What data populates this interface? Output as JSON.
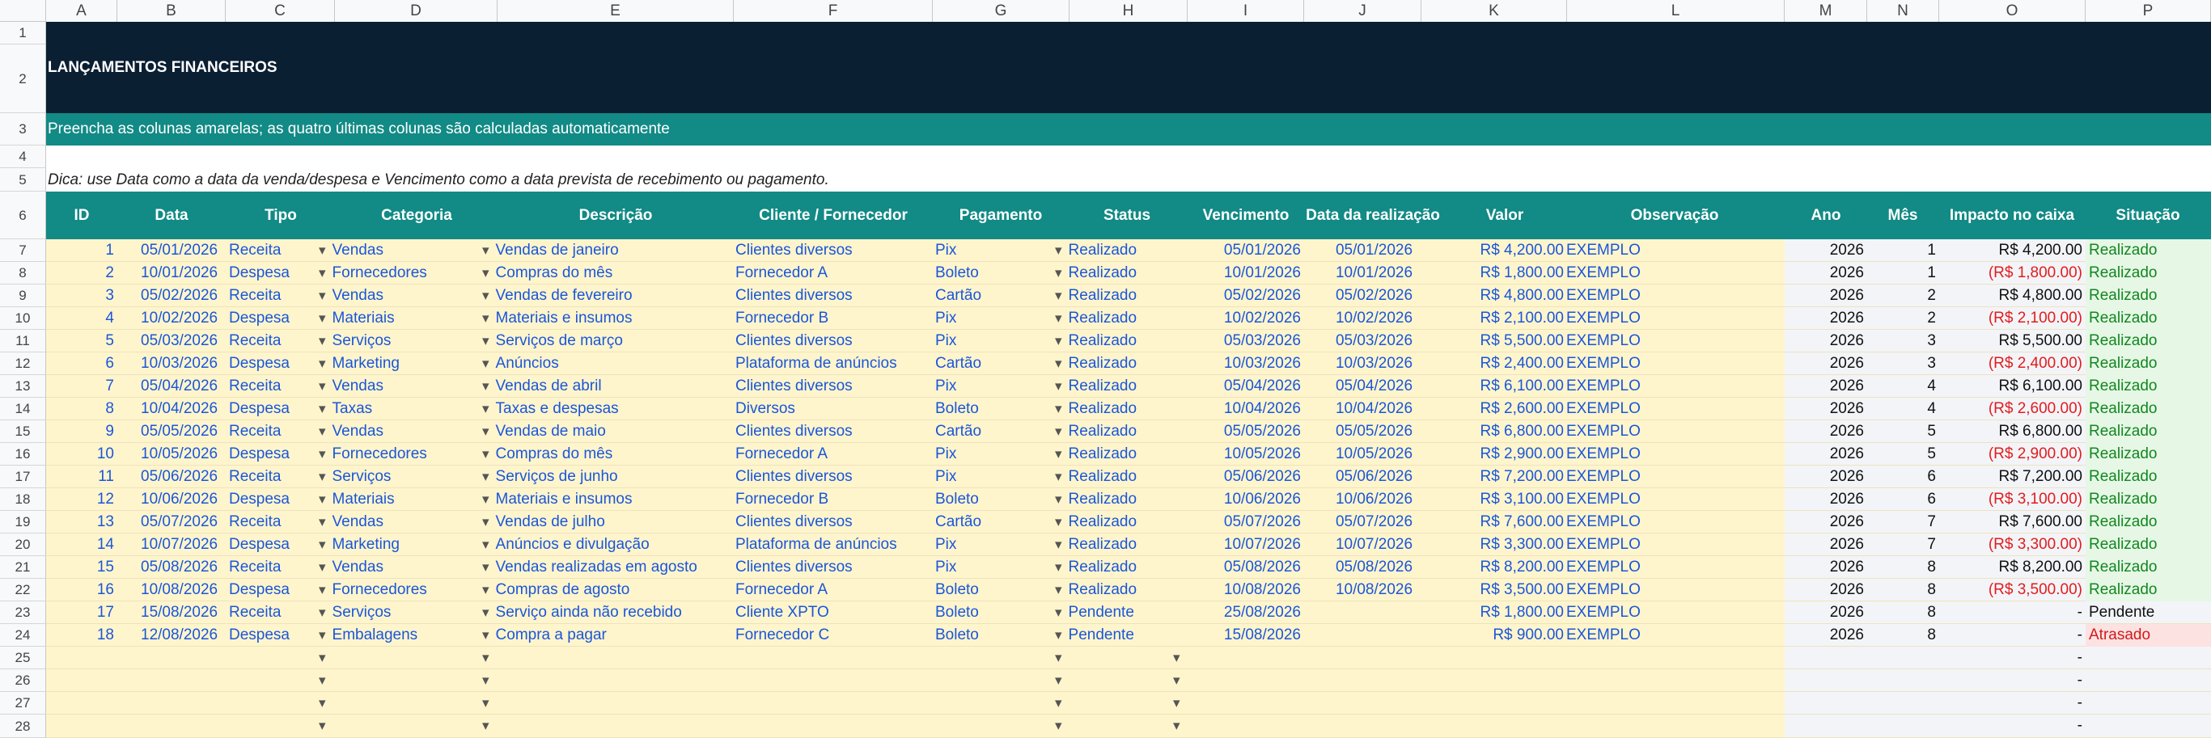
{
  "columns": [
    "A",
    "B",
    "C",
    "D",
    "E",
    "F",
    "G",
    "H",
    "I",
    "J",
    "K",
    "L",
    "M",
    "N",
    "O",
    "P"
  ],
  "title": "LANÇAMENTOS FINANCEIROS",
  "subtitle": "Preencha as colunas amarelas; as quatro últimas colunas são calculadas automaticamente",
  "tip": "Dica: use Data como a data da venda/despesa e Vencimento como a data prevista de recebimento ou pagamento.",
  "headers": [
    "ID",
    "Data",
    "Tipo",
    "Categoria",
    "Descrição",
    "Cliente / Fornecedor",
    "Pagamento",
    "Status",
    "Vencimento",
    "Data da realização",
    "Valor",
    "Observação",
    "Ano",
    "Mês",
    "Impacto no caixa",
    "Situação"
  ],
  "rows": [
    {
      "id": "1",
      "data": "05/01/2026",
      "tipo": "Receita",
      "categoria": "Vendas",
      "descricao": "Vendas de janeiro",
      "cliente": "Clientes diversos",
      "pagamento": "Pix",
      "status": "Realizado",
      "vencimento": "05/01/2026",
      "realizacao": "05/01/2026",
      "valor": "R$ 4,200.00",
      "obs": "EXEMPLO",
      "ano": "2026",
      "mes": "1",
      "impacto": "R$ 4,200.00",
      "neg": false,
      "situacao": "Realizado",
      "sit": "ok"
    },
    {
      "id": "2",
      "data": "10/01/2026",
      "tipo": "Despesa",
      "categoria": "Fornecedores",
      "descricao": "Compras do mês",
      "cliente": "Fornecedor A",
      "pagamento": "Boleto",
      "status": "Realizado",
      "vencimento": "10/01/2026",
      "realizacao": "10/01/2026",
      "valor": "R$ 1,800.00",
      "obs": "EXEMPLO",
      "ano": "2026",
      "mes": "1",
      "impacto": "(R$ 1,800.00)",
      "neg": true,
      "situacao": "Realizado",
      "sit": "ok"
    },
    {
      "id": "3",
      "data": "05/02/2026",
      "tipo": "Receita",
      "categoria": "Vendas",
      "descricao": "Vendas de fevereiro",
      "cliente": "Clientes diversos",
      "pagamento": "Cartão",
      "status": "Realizado",
      "vencimento": "05/02/2026",
      "realizacao": "05/02/2026",
      "valor": "R$ 4,800.00",
      "obs": "EXEMPLO",
      "ano": "2026",
      "mes": "2",
      "impacto": "R$ 4,800.00",
      "neg": false,
      "situacao": "Realizado",
      "sit": "ok"
    },
    {
      "id": "4",
      "data": "10/02/2026",
      "tipo": "Despesa",
      "categoria": "Materiais",
      "descricao": "Materiais e insumos",
      "cliente": "Fornecedor B",
      "pagamento": "Pix",
      "status": "Realizado",
      "vencimento": "10/02/2026",
      "realizacao": "10/02/2026",
      "valor": "R$ 2,100.00",
      "obs": "EXEMPLO",
      "ano": "2026",
      "mes": "2",
      "impacto": "(R$ 2,100.00)",
      "neg": true,
      "situacao": "Realizado",
      "sit": "ok"
    },
    {
      "id": "5",
      "data": "05/03/2026",
      "tipo": "Receita",
      "categoria": "Serviços",
      "descricao": "Serviços de março",
      "cliente": "Clientes diversos",
      "pagamento": "Pix",
      "status": "Realizado",
      "vencimento": "05/03/2026",
      "realizacao": "05/03/2026",
      "valor": "R$ 5,500.00",
      "obs": "EXEMPLO",
      "ano": "2026",
      "mes": "3",
      "impacto": "R$ 5,500.00",
      "neg": false,
      "situacao": "Realizado",
      "sit": "ok"
    },
    {
      "id": "6",
      "data": "10/03/2026",
      "tipo": "Despesa",
      "categoria": "Marketing",
      "descricao": "Anúncios",
      "cliente": "Plataforma de anúncios",
      "pagamento": "Cartão",
      "status": "Realizado",
      "vencimento": "10/03/2026",
      "realizacao": "10/03/2026",
      "valor": "R$ 2,400.00",
      "obs": "EXEMPLO",
      "ano": "2026",
      "mes": "3",
      "impacto": "(R$ 2,400.00)",
      "neg": true,
      "situacao": "Realizado",
      "sit": "ok"
    },
    {
      "id": "7",
      "data": "05/04/2026",
      "tipo": "Receita",
      "categoria": "Vendas",
      "descricao": "Vendas de abril",
      "cliente": "Clientes diversos",
      "pagamento": "Pix",
      "status": "Realizado",
      "vencimento": "05/04/2026",
      "realizacao": "05/04/2026",
      "valor": "R$ 6,100.00",
      "obs": "EXEMPLO",
      "ano": "2026",
      "mes": "4",
      "impacto": "R$ 6,100.00",
      "neg": false,
      "situacao": "Realizado",
      "sit": "ok"
    },
    {
      "id": "8",
      "data": "10/04/2026",
      "tipo": "Despesa",
      "categoria": "Taxas",
      "descricao": "Taxas e despesas",
      "cliente": "Diversos",
      "pagamento": "Boleto",
      "status": "Realizado",
      "vencimento": "10/04/2026",
      "realizacao": "10/04/2026",
      "valor": "R$ 2,600.00",
      "obs": "EXEMPLO",
      "ano": "2026",
      "mes": "4",
      "impacto": "(R$ 2,600.00)",
      "neg": true,
      "situacao": "Realizado",
      "sit": "ok"
    },
    {
      "id": "9",
      "data": "05/05/2026",
      "tipo": "Receita",
      "categoria": "Vendas",
      "descricao": "Vendas de maio",
      "cliente": "Clientes diversos",
      "pagamento": "Cartão",
      "status": "Realizado",
      "vencimento": "05/05/2026",
      "realizacao": "05/05/2026",
      "valor": "R$ 6,800.00",
      "obs": "EXEMPLO",
      "ano": "2026",
      "mes": "5",
      "impacto": "R$ 6,800.00",
      "neg": false,
      "situacao": "Realizado",
      "sit": "ok"
    },
    {
      "id": "10",
      "data": "10/05/2026",
      "tipo": "Despesa",
      "categoria": "Fornecedores",
      "descricao": "Compras do mês",
      "cliente": "Fornecedor A",
      "pagamento": "Pix",
      "status": "Realizado",
      "vencimento": "10/05/2026",
      "realizacao": "10/05/2026",
      "valor": "R$ 2,900.00",
      "obs": "EXEMPLO",
      "ano": "2026",
      "mes": "5",
      "impacto": "(R$ 2,900.00)",
      "neg": true,
      "situacao": "Realizado",
      "sit": "ok"
    },
    {
      "id": "11",
      "data": "05/06/2026",
      "tipo": "Receita",
      "categoria": "Serviços",
      "descricao": "Serviços de junho",
      "cliente": "Clientes diversos",
      "pagamento": "Pix",
      "status": "Realizado",
      "vencimento": "05/06/2026",
      "realizacao": "05/06/2026",
      "valor": "R$ 7,200.00",
      "obs": "EXEMPLO",
      "ano": "2026",
      "mes": "6",
      "impacto": "R$ 7,200.00",
      "neg": false,
      "situacao": "Realizado",
      "sit": "ok"
    },
    {
      "id": "12",
      "data": "10/06/2026",
      "tipo": "Despesa",
      "categoria": "Materiais",
      "descricao": "Materiais e insumos",
      "cliente": "Fornecedor B",
      "pagamento": "Boleto",
      "status": "Realizado",
      "vencimento": "10/06/2026",
      "realizacao": "10/06/2026",
      "valor": "R$ 3,100.00",
      "obs": "EXEMPLO",
      "ano": "2026",
      "mes": "6",
      "impacto": "(R$ 3,100.00)",
      "neg": true,
      "situacao": "Realizado",
      "sit": "ok"
    },
    {
      "id": "13",
      "data": "05/07/2026",
      "tipo": "Receita",
      "categoria": "Vendas",
      "descricao": "Vendas de julho",
      "cliente": "Clientes diversos",
      "pagamento": "Cartão",
      "status": "Realizado",
      "vencimento": "05/07/2026",
      "realizacao": "05/07/2026",
      "valor": "R$ 7,600.00",
      "obs": "EXEMPLO",
      "ano": "2026",
      "mes": "7",
      "impacto": "R$ 7,600.00",
      "neg": false,
      "situacao": "Realizado",
      "sit": "ok"
    },
    {
      "id": "14",
      "data": "10/07/2026",
      "tipo": "Despesa",
      "categoria": "Marketing",
      "descricao": "Anúncios e divulgação",
      "cliente": "Plataforma de anúncios",
      "pagamento": "Pix",
      "status": "Realizado",
      "vencimento": "10/07/2026",
      "realizacao": "10/07/2026",
      "valor": "R$ 3,300.00",
      "obs": "EXEMPLO",
      "ano": "2026",
      "mes": "7",
      "impacto": "(R$ 3,300.00)",
      "neg": true,
      "situacao": "Realizado",
      "sit": "ok"
    },
    {
      "id": "15",
      "data": "05/08/2026",
      "tipo": "Receita",
      "categoria": "Vendas",
      "descricao": "Vendas realizadas em agosto",
      "cliente": "Clientes diversos",
      "pagamento": "Pix",
      "status": "Realizado",
      "vencimento": "05/08/2026",
      "realizacao": "05/08/2026",
      "valor": "R$ 8,200.00",
      "obs": "EXEMPLO",
      "ano": "2026",
      "mes": "8",
      "impacto": "R$ 8,200.00",
      "neg": false,
      "situacao": "Realizado",
      "sit": "ok"
    },
    {
      "id": "16",
      "data": "10/08/2026",
      "tipo": "Despesa",
      "categoria": "Fornecedores",
      "descricao": "Compras de agosto",
      "cliente": "Fornecedor A",
      "pagamento": "Boleto",
      "status": "Realizado",
      "vencimento": "10/08/2026",
      "realizacao": "10/08/2026",
      "valor": "R$ 3,500.00",
      "obs": "EXEMPLO",
      "ano": "2026",
      "mes": "8",
      "impacto": "(R$ 3,500.00)",
      "neg": true,
      "situacao": "Realizado",
      "sit": "ok"
    },
    {
      "id": "17",
      "data": "15/08/2026",
      "tipo": "Receita",
      "categoria": "Serviços",
      "descricao": "Serviço ainda não recebido",
      "cliente": "Cliente XPTO",
      "pagamento": "Boleto",
      "status": "Pendente",
      "vencimento": "25/08/2026",
      "realizacao": "",
      "valor": "R$ 1,800.00",
      "obs": "EXEMPLO",
      "ano": "2026",
      "mes": "8",
      "impacto": "-",
      "neg": false,
      "situacao": "Pendente",
      "sit": "pend"
    },
    {
      "id": "18",
      "data": "12/08/2026",
      "tipo": "Despesa",
      "categoria": "Embalagens",
      "descricao": "Compra a pagar",
      "cliente": "Fornecedor C",
      "pagamento": "Boleto",
      "status": "Pendente",
      "vencimento": "15/08/2026",
      "realizacao": "",
      "valor": "R$ 900.00",
      "obs": "EXEMPLO",
      "ano": "2026",
      "mes": "8",
      "impacto": "-",
      "neg": false,
      "situacao": "Atrasado",
      "sit": "late"
    }
  ],
  "empty_rows_impacto": [
    "-",
    "-",
    "-",
    "-"
  ],
  "row_numbers": [
    "1",
    "2",
    "3",
    "4",
    "5",
    "6",
    "7",
    "8",
    "9",
    "10",
    "11",
    "12",
    "13",
    "14",
    "15",
    "16",
    "17",
    "18",
    "19",
    "20",
    "21",
    "22",
    "23",
    "24",
    "25",
    "26",
    "27",
    "28"
  ],
  "colors": {
    "title_bg": "#0b1f33",
    "header_bg": "#128a85",
    "input_bg": "#fff5cc",
    "input_text": "#1a56db",
    "negative": "#e11d1d",
    "positive_status": "#12871f",
    "late_status": "#d11a1a"
  }
}
